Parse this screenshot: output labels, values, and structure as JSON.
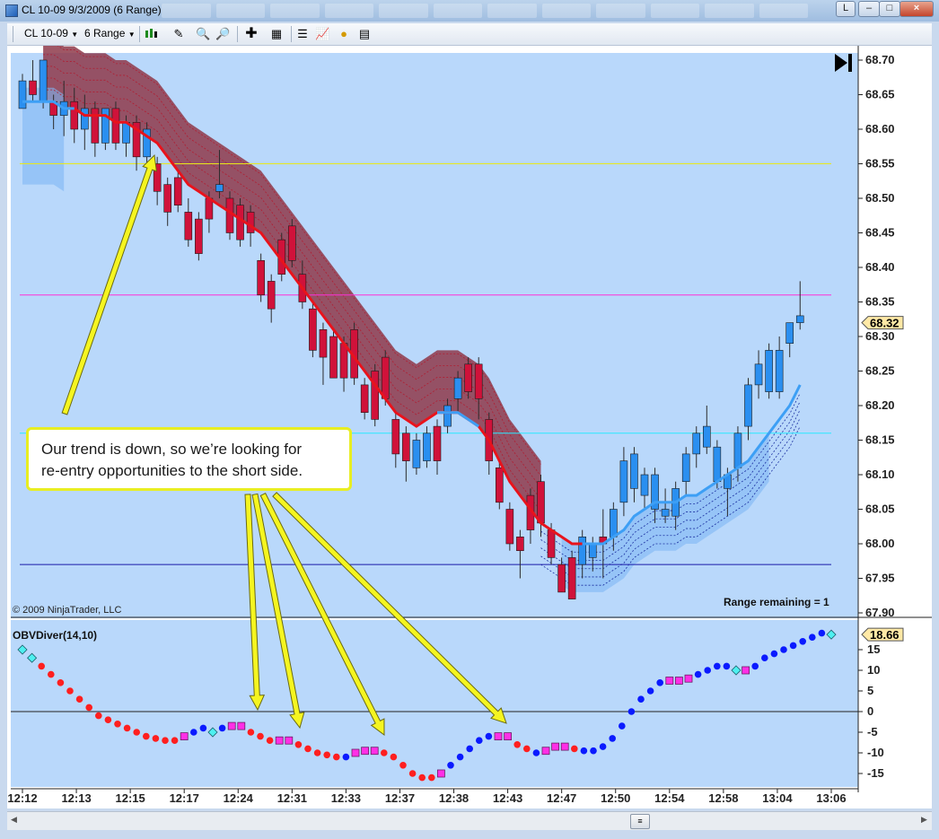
{
  "window": {
    "title": "CL 10-09  9/3/2009 (6 Range)",
    "controls": {
      "l": "L",
      "minimize": "–",
      "maximize": "□",
      "close": "×"
    }
  },
  "toolbar": {
    "instrument": "CL 10-09",
    "period": "6 Range",
    "icons": [
      "candlestick-icon",
      "pencil-icon",
      "zoom-in-icon",
      "zoom-out-icon",
      "crosshair-icon",
      "properties-icon",
      "strategy-icon",
      "chart-icon",
      "currency-icon",
      "data-box-icon"
    ]
  },
  "chart_data": [
    {
      "type": "candlestick",
      "title": "",
      "ylim": [
        67.9,
        68.7
      ],
      "y_ticks": [
        "68.70",
        "68.65",
        "68.60",
        "68.55",
        "68.50",
        "68.45",
        "68.40",
        "68.35",
        "68.30",
        "68.25",
        "68.20",
        "68.15",
        "68.10",
        "68.05",
        "68.00",
        "67.95",
        "67.90"
      ],
      "last_price": "68.32",
      "range_remaining": "Range remaining = 1",
      "copyright": "© 2009 NinjaTrader, LLC",
      "horizontal_lines": [
        {
          "y": 68.55,
          "color": "#e8e81a"
        },
        {
          "y": 68.36,
          "color": "#ff2fd6"
        },
        {
          "y": 68.16,
          "color": "#2be9ff"
        },
        {
          "y": 67.97,
          "color": "#1a1aa8"
        }
      ],
      "colors": {
        "up": "#2a8ff0",
        "down": "#d0123a",
        "wick": "#2b2b2b",
        "background": "#b9d8fb"
      },
      "candles": [
        [
          68.63,
          68.67,
          68.68,
          68.63
        ],
        [
          68.67,
          68.65,
          68.7,
          68.64
        ],
        [
          68.64,
          68.7,
          68.7,
          68.63
        ],
        [
          68.64,
          68.62,
          68.65,
          68.6
        ],
        [
          68.62,
          68.64,
          68.67,
          68.59
        ],
        [
          68.64,
          68.6,
          68.66,
          68.58
        ],
        [
          68.6,
          68.63,
          68.65,
          68.57
        ],
        [
          68.63,
          68.58,
          68.64,
          68.56
        ],
        [
          68.58,
          68.63,
          68.63,
          68.57
        ],
        [
          68.63,
          68.58,
          68.64,
          68.57
        ],
        [
          68.58,
          68.61,
          68.62,
          68.56
        ],
        [
          68.61,
          68.56,
          68.62,
          68.54
        ],
        [
          68.56,
          68.6,
          68.61,
          68.55
        ],
        [
          68.55,
          68.51,
          68.56,
          68.49
        ],
        [
          68.52,
          68.48,
          68.53,
          68.46
        ],
        [
          68.53,
          68.49,
          68.54,
          68.48
        ],
        [
          68.48,
          68.44,
          68.5,
          68.43
        ],
        [
          68.47,
          68.42,
          68.48,
          68.41
        ],
        [
          68.5,
          68.47,
          68.51,
          68.45
        ],
        [
          68.51,
          68.52,
          68.57,
          68.5
        ],
        [
          68.5,
          68.45,
          68.51,
          68.44
        ],
        [
          68.49,
          68.44,
          68.5,
          68.43
        ],
        [
          68.48,
          68.45,
          68.49,
          68.43
        ],
        [
          68.41,
          68.36,
          68.42,
          68.35
        ],
        [
          68.38,
          68.34,
          68.39,
          68.32
        ],
        [
          68.44,
          68.39,
          68.45,
          68.38
        ],
        [
          68.46,
          68.41,
          68.47,
          68.4
        ],
        [
          68.39,
          68.35,
          68.41,
          68.34
        ],
        [
          68.34,
          68.28,
          68.35,
          68.27
        ],
        [
          68.31,
          68.27,
          68.32,
          68.23
        ],
        [
          68.3,
          68.24,
          68.31,
          68.24
        ],
        [
          68.29,
          68.24,
          68.3,
          68.22
        ],
        [
          68.31,
          68.24,
          68.32,
          68.23
        ],
        [
          68.23,
          68.19,
          68.24,
          68.18
        ],
        [
          68.25,
          68.18,
          68.26,
          68.17
        ],
        [
          68.27,
          68.21,
          68.28,
          68.2
        ],
        [
          68.18,
          68.13,
          68.19,
          68.11
        ],
        [
          68.16,
          68.12,
          68.17,
          68.09
        ],
        [
          68.11,
          68.15,
          68.16,
          68.1
        ],
        [
          68.12,
          68.16,
          68.17,
          68.11
        ],
        [
          68.17,
          68.12,
          68.18,
          68.1
        ],
        [
          68.17,
          68.2,
          68.21,
          68.16
        ],
        [
          68.21,
          68.24,
          68.25,
          68.19
        ],
        [
          68.26,
          68.22,
          68.27,
          68.21
        ],
        [
          68.26,
          68.21,
          68.27,
          68.18
        ],
        [
          68.18,
          68.12,
          68.19,
          68.1
        ],
        [
          68.11,
          68.06,
          68.12,
          68.05
        ],
        [
          68.05,
          68.0,
          68.06,
          67.99
        ],
        [
          68.01,
          67.99,
          68.02,
          67.95
        ],
        [
          68.07,
          68.02,
          68.08,
          68.0
        ],
        [
          68.09,
          68.03,
          68.1,
          68.01
        ],
        [
          68.02,
          67.98,
          68.03,
          67.97
        ],
        [
          67.97,
          67.93,
          67.98,
          67.93
        ],
        [
          67.98,
          67.92,
          67.99,
          67.92
        ],
        [
          67.97,
          68.01,
          68.02,
          67.95
        ],
        [
          67.98,
          68.0,
          68.01,
          67.96
        ],
        [
          68.01,
          68.0,
          68.05,
          67.95
        ],
        [
          68.01,
          68.05,
          68.06,
          67.99
        ],
        [
          68.06,
          68.12,
          68.14,
          68.04
        ],
        [
          68.08,
          68.13,
          68.14,
          68.06
        ],
        [
          68.07,
          68.1,
          68.11,
          68.05
        ],
        [
          68.05,
          68.1,
          68.11,
          68.03
        ],
        [
          68.04,
          68.05,
          68.08,
          68.03
        ],
        [
          68.04,
          68.08,
          68.09,
          68.02
        ],
        [
          68.09,
          68.13,
          68.14,
          68.07
        ],
        [
          68.13,
          68.16,
          68.17,
          68.11
        ],
        [
          68.14,
          68.17,
          68.2,
          68.13
        ],
        [
          68.09,
          68.14,
          68.15,
          68.08
        ],
        [
          68.08,
          68.1,
          68.11,
          68.04
        ],
        [
          68.11,
          68.16,
          68.17,
          68.09
        ],
        [
          68.17,
          68.23,
          68.24,
          68.15
        ],
        [
          68.23,
          68.26,
          68.28,
          68.21
        ],
        [
          68.22,
          68.28,
          68.29,
          68.21
        ],
        [
          68.22,
          68.28,
          68.3,
          68.21
        ],
        [
          68.29,
          68.32,
          68.32,
          68.27
        ],
        [
          68.32,
          68.33,
          68.38,
          68.31
        ]
      ],
      "trend_line": {
        "down_color": "#e8131c",
        "up_color": "#3d9ff5",
        "values": [
          68.64,
          68.64,
          68.64,
          68.64,
          68.63,
          68.63,
          68.62,
          68.62,
          68.62,
          68.61,
          68.61,
          68.6,
          68.59,
          68.58,
          68.56,
          68.54,
          68.52,
          68.51,
          68.5,
          68.49,
          68.48,
          68.47,
          68.46,
          68.45,
          68.43,
          68.41,
          68.39,
          68.37,
          68.35,
          68.33,
          68.31,
          68.29,
          68.27,
          68.25,
          68.23,
          68.21,
          68.19,
          68.18,
          68.17,
          68.18,
          68.19,
          68.19,
          68.19,
          68.18,
          68.17,
          68.15,
          68.12,
          68.09,
          68.07,
          68.05,
          68.03,
          68.02,
          68.01,
          68.0,
          68.0,
          68.0,
          68.0,
          68.01,
          68.02,
          68.04,
          68.05,
          68.06,
          68.06,
          68.06,
          68.07,
          68.07,
          68.08,
          68.09,
          68.1,
          68.11,
          68.12,
          68.14,
          68.16,
          68.18,
          68.2,
          68.23
        ]
      }
    },
    {
      "type": "scatter",
      "title": "OBVDiver(14,10)",
      "ylim": [
        -17,
        20
      ],
      "y_ticks": [
        "15",
        "10",
        "5",
        "0",
        "-5",
        "-10",
        "-15"
      ],
      "last_value": "18.66",
      "colors": {
        "red": "#ff1f1f",
        "blue": "#0a1aff",
        "magenta": "#ff2fe6",
        "cyan": "#4ef0f0"
      },
      "points": [
        [
          15,
          "cyan"
        ],
        [
          13,
          "cyan"
        ],
        [
          11,
          "red"
        ],
        [
          9,
          "red"
        ],
        [
          7,
          "red"
        ],
        [
          5,
          "red"
        ],
        [
          3,
          "red"
        ],
        [
          1,
          "red"
        ],
        [
          -1,
          "red"
        ],
        [
          -2,
          "red"
        ],
        [
          -3,
          "red"
        ],
        [
          -4,
          "red"
        ],
        [
          -5,
          "red"
        ],
        [
          -6,
          "red"
        ],
        [
          -6.5,
          "red"
        ],
        [
          -7,
          "red"
        ],
        [
          -7,
          "red"
        ],
        [
          -6,
          "magenta"
        ],
        [
          -5,
          "blue"
        ],
        [
          -4,
          "blue"
        ],
        [
          -5,
          "cyan"
        ],
        [
          -4,
          "blue"
        ],
        [
          -3.5,
          "magenta"
        ],
        [
          -3.5,
          "magenta"
        ],
        [
          -5,
          "red"
        ],
        [
          -6,
          "red"
        ],
        [
          -7,
          "red"
        ],
        [
          -7,
          "magenta"
        ],
        [
          -7,
          "magenta"
        ],
        [
          -8,
          "red"
        ],
        [
          -9,
          "red"
        ],
        [
          -10,
          "red"
        ],
        [
          -10.5,
          "red"
        ],
        [
          -11,
          "red"
        ],
        [
          -11,
          "blue"
        ],
        [
          -10,
          "magenta"
        ],
        [
          -9.5,
          "magenta"
        ],
        [
          -9.5,
          "magenta"
        ],
        [
          -10,
          "red"
        ],
        [
          -11,
          "red"
        ],
        [
          -13,
          "red"
        ],
        [
          -15,
          "red"
        ],
        [
          -16,
          "red"
        ],
        [
          -16,
          "red"
        ],
        [
          -15,
          "magenta"
        ],
        [
          -13,
          "blue"
        ],
        [
          -11,
          "blue"
        ],
        [
          -9,
          "blue"
        ],
        [
          -7,
          "blue"
        ],
        [
          -6,
          "blue"
        ],
        [
          -6,
          "magenta"
        ],
        [
          -6,
          "magenta"
        ],
        [
          -8,
          "red"
        ],
        [
          -9,
          "red"
        ],
        [
          -10,
          "blue"
        ],
        [
          -9.5,
          "magenta"
        ],
        [
          -8.5,
          "magenta"
        ],
        [
          -8.5,
          "magenta"
        ],
        [
          -9,
          "red"
        ],
        [
          -9.5,
          "blue"
        ],
        [
          -9.5,
          "blue"
        ],
        [
          -8.5,
          "blue"
        ],
        [
          -6.5,
          "blue"
        ],
        [
          -3.5,
          "blue"
        ],
        [
          0,
          "blue"
        ],
        [
          3,
          "blue"
        ],
        [
          5,
          "blue"
        ],
        [
          7,
          "blue"
        ],
        [
          7.5,
          "magenta"
        ],
        [
          7.5,
          "magenta"
        ],
        [
          8,
          "magenta"
        ],
        [
          9,
          "blue"
        ],
        [
          10,
          "blue"
        ],
        [
          11,
          "blue"
        ],
        [
          11,
          "blue"
        ],
        [
          10,
          "cyan"
        ],
        [
          10,
          "magenta"
        ],
        [
          11,
          "blue"
        ],
        [
          13,
          "blue"
        ],
        [
          14,
          "blue"
        ],
        [
          15,
          "blue"
        ],
        [
          16,
          "blue"
        ],
        [
          17,
          "blue"
        ],
        [
          18,
          "blue"
        ],
        [
          19,
          "blue"
        ],
        [
          18.66,
          "cyan"
        ]
      ]
    }
  ],
  "x_axis": {
    "labels": [
      "12:12",
      "12:13",
      "12:15",
      "12:17",
      "12:24",
      "12:31",
      "12:33",
      "12:37",
      "12:38",
      "12:43",
      "12:47",
      "12:50",
      "12:54",
      "12:58",
      "13:04",
      "13:06"
    ]
  },
  "annotation": {
    "text_line1": "Our trend is down, so we’re looking for",
    "text_line2": "re-entry opportunities to the short side."
  }
}
